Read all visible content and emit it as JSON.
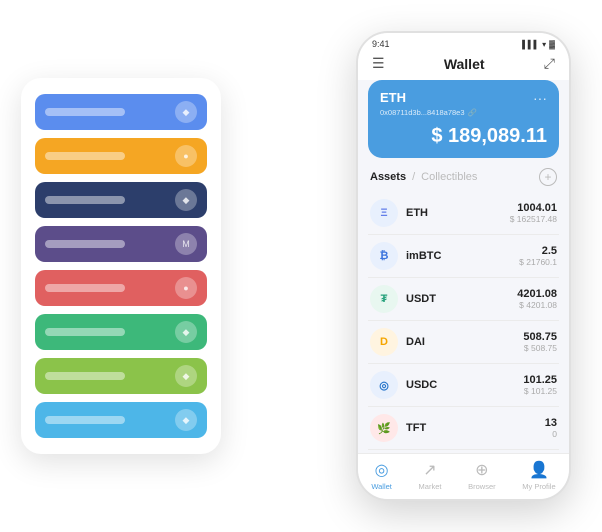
{
  "left_panel": {
    "cards": [
      {
        "color": "card-blue",
        "icon": "◆"
      },
      {
        "color": "card-yellow",
        "icon": "●"
      },
      {
        "color": "card-dark",
        "icon": "◆"
      },
      {
        "color": "card-purple",
        "icon": "M"
      },
      {
        "color": "card-red",
        "icon": "●"
      },
      {
        "color": "card-green",
        "icon": "◆"
      },
      {
        "color": "card-lime",
        "icon": "◆"
      },
      {
        "color": "card-sky",
        "icon": "◆"
      }
    ]
  },
  "phone": {
    "status_bar": {
      "time": "9:41",
      "signal": "▌▌▌",
      "wifi": "◀",
      "battery": "▓"
    },
    "header": {
      "title": "Wallet",
      "menu_icon": "☰",
      "expand_icon": "⤢"
    },
    "eth_card": {
      "title": "ETH",
      "address": "0x08711d3b...8418a78e3",
      "amount": "$ 189,089.11",
      "dots": "···"
    },
    "assets": {
      "tab_active": "Assets",
      "tab_separator": "/",
      "tab_inactive": "Collectibles",
      "add_btn": "+"
    },
    "asset_list": [
      {
        "name": "ETH",
        "icon_class": "asset-icon-eth",
        "icon_text": "Ξ",
        "amount": "1004.01",
        "usd": "$ 162517.48"
      },
      {
        "name": "imBTC",
        "icon_class": "asset-icon-imbtc",
        "icon_text": "₿",
        "amount": "2.5",
        "usd": "$ 21760.1"
      },
      {
        "name": "USDT",
        "icon_class": "asset-icon-usdt",
        "icon_text": "₮",
        "amount": "4201.08",
        "usd": "$ 4201.08"
      },
      {
        "name": "DAI",
        "icon_class": "asset-icon-dai",
        "icon_text": "D",
        "amount": "508.75",
        "usd": "$ 508.75"
      },
      {
        "name": "USDC",
        "icon_class": "asset-icon-usdc",
        "icon_text": "◎",
        "amount": "101.25",
        "usd": "$ 101.25"
      },
      {
        "name": "TFT",
        "icon_class": "asset-icon-tft",
        "icon_text": "🌿",
        "amount": "13",
        "usd": "0"
      }
    ],
    "bottom_nav": [
      {
        "id": "wallet",
        "icon": "◎",
        "label": "Wallet",
        "active": true
      },
      {
        "id": "market",
        "icon": "↗",
        "label": "Market",
        "active": false
      },
      {
        "id": "browser",
        "icon": "⊕",
        "label": "Browser",
        "active": false
      },
      {
        "id": "my-profile",
        "icon": "👤",
        "label": "My Profile",
        "active": false
      }
    ]
  }
}
